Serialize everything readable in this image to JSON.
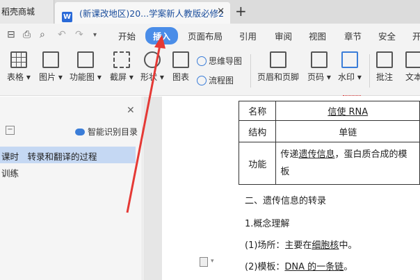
{
  "tabs": {
    "store_label": "稻壳商城",
    "doc_title": "(新课改地区)20...学案新人教版必修2",
    "doc_icon": "W",
    "close": "✕",
    "add": "+"
  },
  "menu": {
    "items": [
      "开始",
      "插入",
      "页面布局",
      "引用",
      "审阅",
      "视图",
      "章节",
      "安全",
      "开"
    ],
    "active": "插入"
  },
  "ribbon": {
    "table": "表格",
    "picture": "图片",
    "function_chart": "功能图",
    "screenshot": "截屏",
    "shape": "形状",
    "chart": "图表",
    "mindmap": "思维导图",
    "flowchart": "流程图",
    "header_footer": "页眉和页脚",
    "page_number": "页码",
    "watermark": "水印",
    "comment": "批注",
    "textbox": "文本"
  },
  "nav": {
    "close": "✕",
    "collapse": "−",
    "smart_toc": "智能识别目录",
    "items": [
      "课时　转录和翻译的过程",
      "训练"
    ]
  },
  "doc": {
    "rows": [
      {
        "label": "名称",
        "value": "信使 RNA"
      },
      {
        "label": "结构",
        "value": "单链"
      },
      {
        "label": "功能",
        "value_prefix": "传递",
        "value_underline": "遗传信息",
        "value_suffix": "，蛋白质合成的模板"
      }
    ],
    "section_heading": "二、遗传信息的转录",
    "concept": "1.概念理解",
    "place_prefix": "(1)场所：主要在",
    "place_underline": "细胞核",
    "place_suffix": "中。",
    "template_prefix": "(2)模板：",
    "template_underline": "DNA 的一条链",
    "template_suffix": "。"
  },
  "colors": {
    "accent": "#4a8de8",
    "arrow": "#e53935",
    "selection": "#c5d8f3"
  }
}
